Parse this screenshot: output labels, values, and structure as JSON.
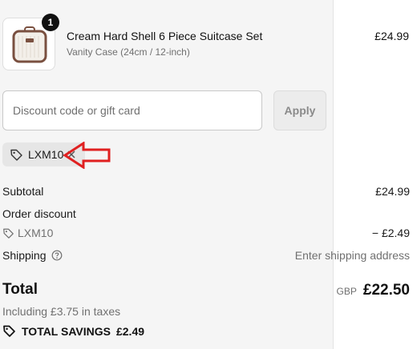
{
  "cart": {
    "item": {
      "quantity": "1",
      "title": "Cream Hard Shell 6 Piece Suitcase Set",
      "variant": "Vanity Case (24cm / 12-inch)",
      "price": "£24.99",
      "image_icon": "suitcase-image"
    }
  },
  "discount": {
    "placeholder": "Discount code or gift card",
    "apply_label": "Apply",
    "applied_code": "LXM10",
    "annotation_color": "#e02020"
  },
  "summary": {
    "subtotal_label": "Subtotal",
    "subtotal_value": "£24.99",
    "order_discount_label": "Order discount",
    "discount_code": "LXM10",
    "discount_value": "− £2.49",
    "shipping_label": "Shipping",
    "shipping_value": "Enter shipping address",
    "total_label": "Total",
    "currency": "GBP",
    "total_value": "£22.50",
    "taxes_text": "Including £3.75 in taxes",
    "savings_label": "TOTAL SAVINGS",
    "savings_value": "£2.49"
  }
}
